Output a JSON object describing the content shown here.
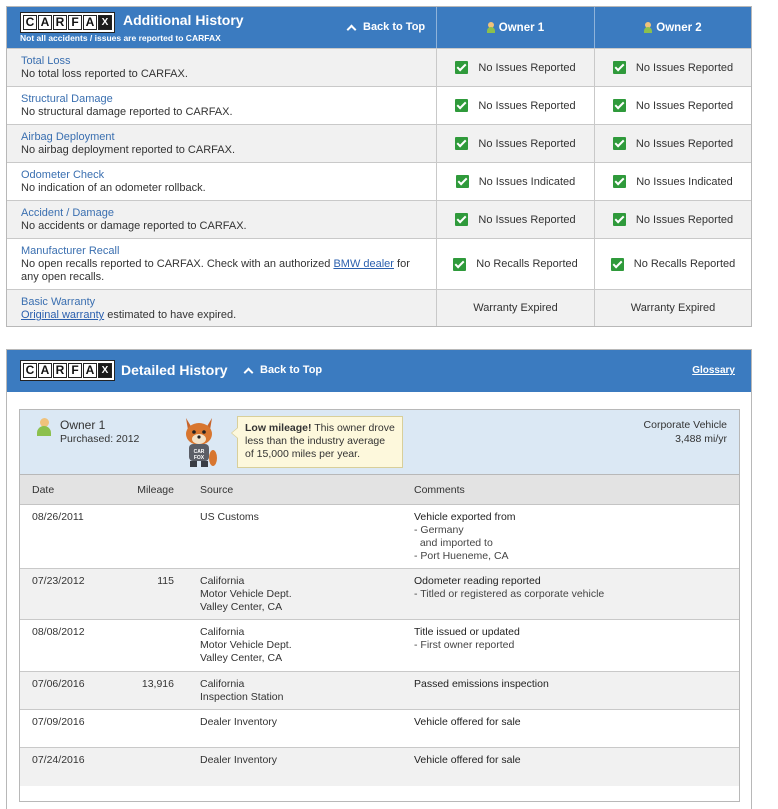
{
  "brand": {
    "logo_letters": [
      "C",
      "A",
      "R",
      "F",
      "A",
      "X"
    ]
  },
  "additional_history": {
    "title": "Additional History",
    "subtitle": "Not all accidents / issues are reported to CARFAX",
    "back_to_top": "Back to Top",
    "owners": [
      "Owner 1",
      "Owner 2"
    ],
    "rows": [
      {
        "label": "Total Loss",
        "desc": "No total loss reported to CARFAX.",
        "status": [
          "No Issues Reported",
          "No Issues Reported"
        ],
        "check": true
      },
      {
        "label": "Structural Damage",
        "desc": "No structural damage reported to CARFAX.",
        "status": [
          "No Issues Reported",
          "No Issues Reported"
        ],
        "check": true
      },
      {
        "label": "Airbag Deployment",
        "desc": "No airbag deployment reported to CARFAX.",
        "status": [
          "No Issues Reported",
          "No Issues Reported"
        ],
        "check": true
      },
      {
        "label": "Odometer Check",
        "desc": "No indication of an odometer rollback.",
        "status": [
          "No Issues Indicated",
          "No Issues Indicated"
        ],
        "check": true
      },
      {
        "label": "Accident / Damage",
        "desc": "No accidents or damage reported to CARFAX.",
        "status": [
          "No Issues Reported",
          "No Issues Reported"
        ],
        "check": true
      },
      {
        "label": "Manufacturer Recall",
        "desc_pre": "No open recalls reported to CARFAX. Check with an authorized ",
        "desc_link": "BMW dealer",
        "desc_post": " for any open recalls.",
        "status": [
          "No Recalls Reported",
          "No Recalls Reported"
        ],
        "check": true
      },
      {
        "label": "Basic Warranty",
        "desc_link": "Original warranty",
        "desc_post": " estimated to have expired.",
        "status": [
          "Warranty Expired",
          "Warranty Expired"
        ],
        "check": false
      }
    ]
  },
  "detailed_history": {
    "title": "Detailed History",
    "back_to_top": "Back to Top",
    "glossary": "Glossary",
    "owner": {
      "name": "Owner 1",
      "purchased": "Purchased: 2012",
      "tip_bold": "Low mileage!",
      "tip_text": " This owner drove less than the industry average of 15,000 miles per year.",
      "vehicle_type": "Corporate Vehicle",
      "avg_miles": "3,488 mi/yr"
    },
    "columns": [
      "Date",
      "Mileage",
      "Source",
      "Comments"
    ],
    "records": [
      {
        "date": "08/26/2011",
        "mileage": "",
        "source": [
          "US Customs"
        ],
        "comment_head": "Vehicle exported from",
        "comment_lines": [
          "- Germany",
          "  and imported to",
          "- Port Hueneme, CA"
        ]
      },
      {
        "date": "07/23/2012",
        "mileage": "115",
        "source": [
          "California",
          "Motor Vehicle Dept.",
          "Valley Center, CA"
        ],
        "comment_head": "Odometer reading reported",
        "comment_lines": [
          "- Titled or registered as corporate vehicle"
        ]
      },
      {
        "date": "08/08/2012",
        "mileage": "",
        "source": [
          "California",
          "Motor Vehicle Dept.",
          "Valley Center, CA"
        ],
        "comment_head": "Title issued or updated",
        "comment_lines": [
          "- First owner reported"
        ]
      },
      {
        "date": "07/06/2016",
        "mileage": "13,916",
        "source": [
          "California",
          "Inspection Station"
        ],
        "comment_head": "Passed emissions inspection",
        "comment_lines": []
      },
      {
        "date": "07/09/2016",
        "mileage": "",
        "source": [
          "Dealer Inventory"
        ],
        "comment_head": "Vehicle offered for sale",
        "comment_lines": []
      },
      {
        "date": "07/24/2016",
        "mileage": "",
        "source": [
          "Dealer Inventory"
        ],
        "comment_head": "Vehicle offered for sale",
        "comment_lines": []
      }
    ]
  }
}
